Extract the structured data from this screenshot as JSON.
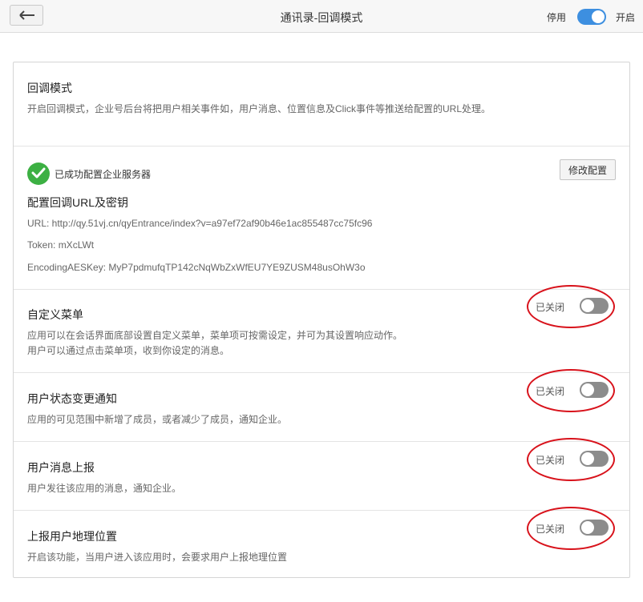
{
  "header": {
    "title": "通讯录-回调模式",
    "toggle_off_label": "停用",
    "toggle_on_label": "开启",
    "toggle_state": "on",
    "accent_color": "#3d8fe0"
  },
  "intro": {
    "heading": "回调模式",
    "description": "开启回调模式，企业号后台将把用户相关事件如，用户消息、位置信息及Click事件等推送给配置的URL处理。"
  },
  "config": {
    "success_icon": "check-circle-icon",
    "success_text": "已成功配置企业服务器",
    "edit_button": "修改配置",
    "title": "配置回调URL及密钥",
    "url_line": "URL: http://qy.51vj.cn/qyEntrance/index?v=a97ef72af90b46e1ac855487cc75fc96",
    "token_line": "Token: mXcLWt",
    "aes_line": "EncodingAESKey: MyP7pdmufqTP142cNqWbZxWfEU7YE9ZUSM48usOhW3o"
  },
  "settings": [
    {
      "title": "自定义菜单",
      "desc_lines": [
        "应用可以在会话界面底部设置自定义菜单，菜单项可按需设定，并可为其设置响应动作。",
        "用户可以通过点击菜单项，收到你设定的消息。"
      ],
      "state_label": "已关闭"
    },
    {
      "title": "用户状态变更通知",
      "desc_lines": [
        "应用的可见范围中新增了成员，或者减少了成员，通知企业。"
      ],
      "state_label": "已关闭"
    },
    {
      "title": "用户消息上报",
      "desc_lines": [
        "用户发往该应用的消息，通知企业。"
      ],
      "state_label": "已关闭"
    },
    {
      "title": "上报用户地理位置",
      "desc_lines": [
        "开启该功能，当用户进入该应用时，会要求用户上报地理位置"
      ],
      "state_label": "已关闭"
    }
  ],
  "annotation_color": "#d8121b"
}
